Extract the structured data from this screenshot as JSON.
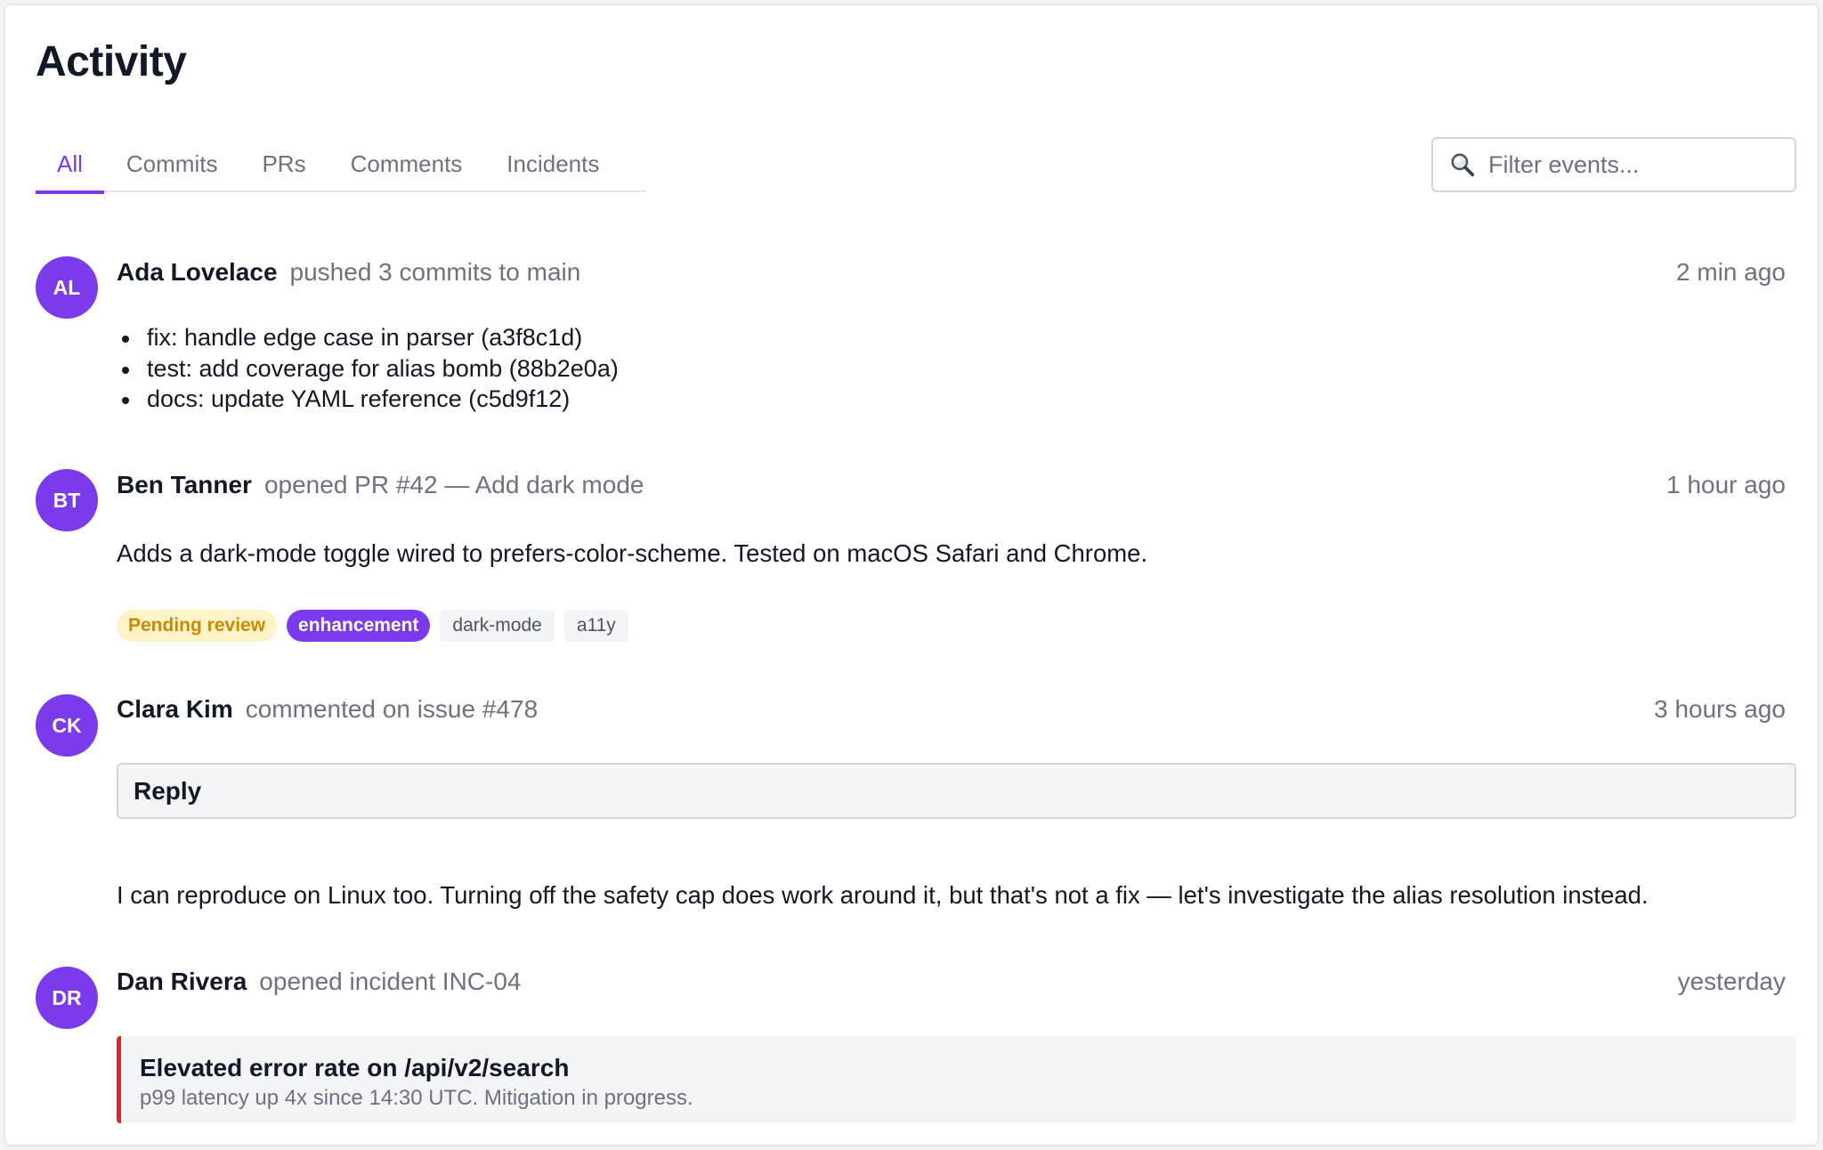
{
  "page": {
    "title": "Activity"
  },
  "tabs": [
    {
      "label": "All",
      "active": true
    },
    {
      "label": "Commits",
      "active": false
    },
    {
      "label": "PRs",
      "active": false
    },
    {
      "label": "Comments",
      "active": false
    },
    {
      "label": "Incidents",
      "active": false
    }
  ],
  "search": {
    "placeholder": "Filter events...",
    "value": "",
    "icon": "search-icon"
  },
  "colors": {
    "accent": "#7c3aed",
    "pending": "#ca8a04",
    "incident": "#dc2626"
  },
  "events": [
    {
      "initials": "AL",
      "actor": "Ada Lovelace",
      "action": "pushed 3 commits to main",
      "time": "2 min ago",
      "commits": [
        "fix: handle edge case in parser (a3f8c1d)",
        "test: add coverage for alias bomb (88b2e0a)",
        "docs: update YAML reference (c5d9f12)"
      ]
    },
    {
      "initials": "BT",
      "actor": "Ben Tanner",
      "action": "opened PR #42 — Add dark mode",
      "time": "1 hour ago",
      "body": "Adds a dark-mode toggle wired to prefers-color-scheme. Tested on macOS Safari and Chrome.",
      "badges": [
        "Pending review",
        "enhancement",
        "dark-mode",
        "a11y"
      ]
    },
    {
      "initials": "CK",
      "actor": "Clara Kim",
      "action": "commented on issue #478",
      "time": "3 hours ago",
      "reply_label": "Reply",
      "body": "I can reproduce on Linux too. Turning off the safety cap does work around it, but that's not a fix — let's investigate the alias resolution instead."
    },
    {
      "initials": "DR",
      "actor": "Dan Rivera",
      "action": "opened incident INC-04",
      "time": "yesterday",
      "incident": {
        "title": "Elevated error rate on /api/v2/search",
        "detail": "p99 latency up 4x since 14:30 UTC. Mitigation in progress."
      }
    }
  ]
}
